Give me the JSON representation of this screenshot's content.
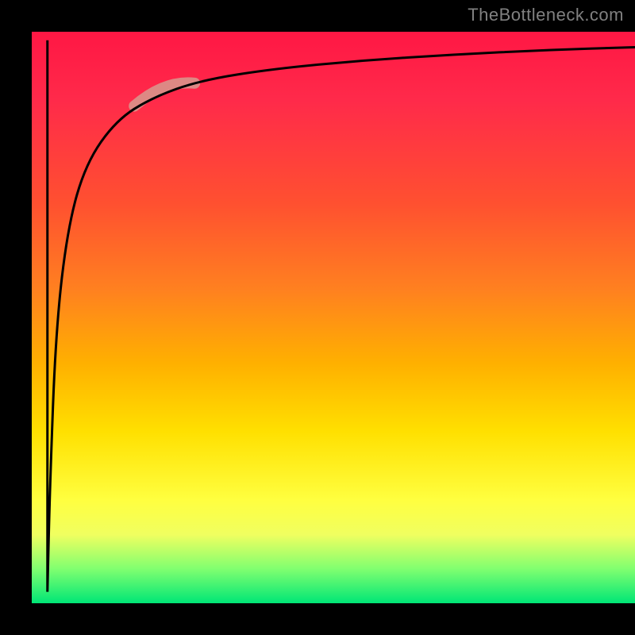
{
  "attribution": "TheBottleneck.com",
  "colors": {
    "gradient_top": "#ff1744",
    "gradient_mid1": "#ff8020",
    "gradient_mid2": "#ffff40",
    "gradient_bottom": "#00e676",
    "curve": "#000000",
    "highlight": "#d89a8f",
    "frame": "#000000"
  },
  "chart_data": {
    "type": "line",
    "title": "",
    "xlabel": "",
    "ylabel": "",
    "xlim": [
      0,
      100
    ],
    "ylim": [
      0,
      100
    ],
    "grid": false,
    "legend": false,
    "description": "Bottleneck-style curve on vertical red→green gradient. The black line plunges from near the top-left straight down to the bottom, then rises sharply and asymptotically approaches the top as x increases (inverse-hyperbolic shape). A short pink highlight segment sits on the rising curve near the upper-left shoulder.",
    "series": [
      {
        "name": "curve",
        "points_xy": [
          [
            2.6,
            98.5
          ],
          [
            2.6,
            2.0
          ],
          [
            3.0,
            20.0
          ],
          [
            4.0,
            48.0
          ],
          [
            6.0,
            66.0
          ],
          [
            9.0,
            77.0
          ],
          [
            14.0,
            84.5
          ],
          [
            20.0,
            88.5
          ],
          [
            28.0,
            91.5
          ],
          [
            40.0,
            93.5
          ],
          [
            55.0,
            95.0
          ],
          [
            70.0,
            96.0
          ],
          [
            85.0,
            96.8
          ],
          [
            100.0,
            97.3
          ]
        ]
      }
    ],
    "highlight_segment": {
      "x_range": [
        17,
        27
      ],
      "y_range": [
        87,
        91
      ]
    }
  }
}
